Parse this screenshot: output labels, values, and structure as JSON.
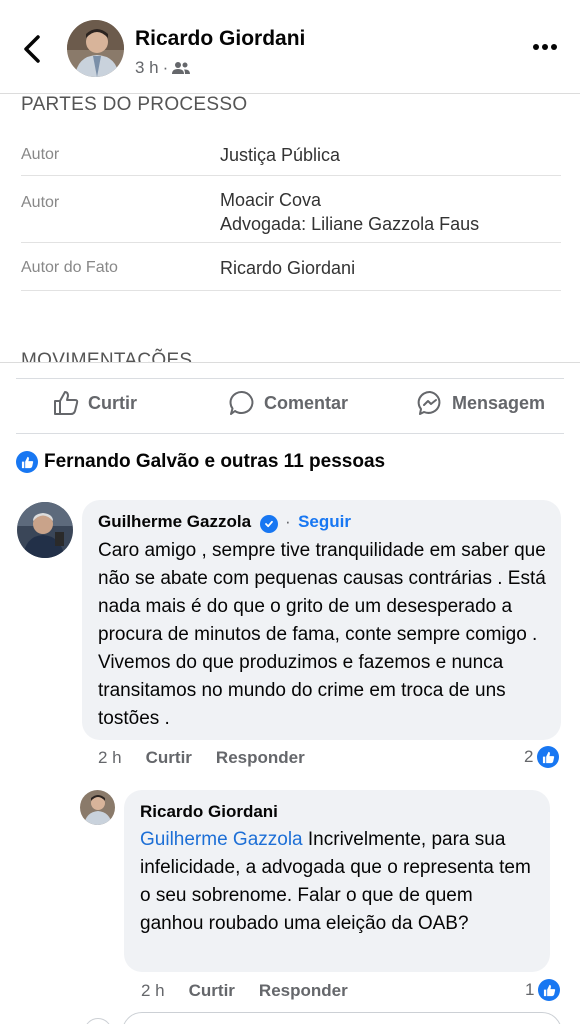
{
  "header": {
    "author": "Ricardo Giordani",
    "time": "3 h",
    "separator": "·",
    "audience_icon": "friends-icon"
  },
  "document": {
    "title": "PARTES DO PROCESSO",
    "rows": [
      {
        "label": "Autor",
        "value_lines": [
          "Justiça Pública"
        ]
      },
      {
        "label": "Autor",
        "value_lines": [
          "Moacir Cova",
          "Advogada:  Liliane Gazzola Faus"
        ]
      },
      {
        "label": "Autor do Fato",
        "value_lines": [
          "Ricardo Giordani"
        ]
      }
    ],
    "next_section_title": "MOVIMENTAÇÕES"
  },
  "actions": {
    "like": "Curtir",
    "comment": "Comentar",
    "message": "Mensagem"
  },
  "reactions": {
    "text": "Fernando Galvão e outras 11 pessoas",
    "icon": "like-icon"
  },
  "comments": [
    {
      "name": "Guilherme Gazzola",
      "verified": true,
      "separator": "·",
      "follow": "Seguir",
      "text": "Caro amigo , sempre tive tranquilidade em saber que não se abate com pequenas causas contrárias . Está nada mais é do que o grito de um desesperado a procura de minutos de fama, conte sempre comigo . Vivemos do que produzimos e fazemos e nunca transitamos no mundo do crime em troca de uns tostões .",
      "time": "2 h",
      "like": "Curtir",
      "reply": "Responder",
      "like_count": "2"
    },
    {
      "name": "Ricardo Giordani",
      "mention": "Guilherme Gazzola",
      "text": " Incrivelmente, para sua infelicidade, a advogada que o representa tem o seu sobrenome. Falar o que de quem ganhou roubado uma eleição da OAB?",
      "time": "2 h",
      "like": "Curtir",
      "reply": "Responder",
      "like_count": "1"
    }
  ],
  "colors": {
    "accent": "#1877f2",
    "bubble": "#f0f2f5",
    "muted": "#65676b",
    "mention": "#1d6fd6"
  }
}
